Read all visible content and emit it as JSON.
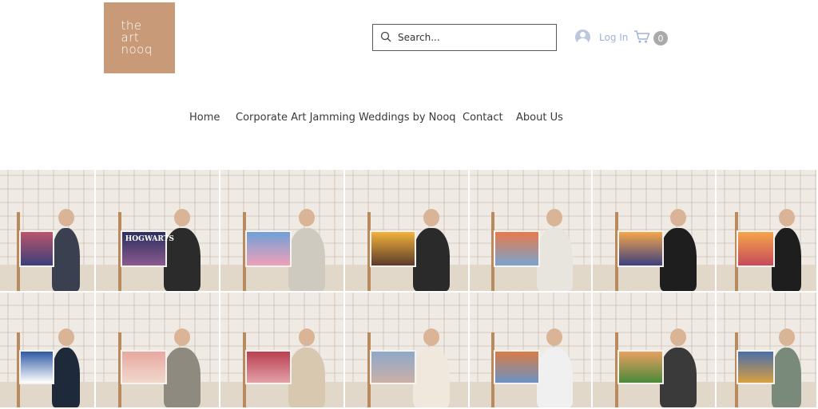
{
  "logo": {
    "lines": [
      "the",
      "art",
      "nooq"
    ],
    "bg_color": "#c89a78"
  },
  "search": {
    "placeholder": "Search...",
    "icon": "search-icon"
  },
  "account": {
    "login_label": "Log In",
    "icon": "user-avatar-icon",
    "color": "#a2b2d6"
  },
  "cart": {
    "count": "0",
    "icon": "cart-icon"
  },
  "nav": {
    "items": [
      {
        "label": "Home"
      },
      {
        "label": "Corporate Art Jamming"
      },
      {
        "label": "Weddings by Nooq"
      },
      {
        "label": "Contact"
      },
      {
        "label": "About Us"
      }
    ]
  },
  "gallery": {
    "rows": 2,
    "columns": 7,
    "photos": [
      {
        "canvas_text": ""
      },
      {
        "canvas_text": "HOGWARTS"
      },
      {
        "canvas_text": ""
      },
      {
        "canvas_text": ""
      },
      {
        "canvas_text": ""
      },
      {
        "canvas_text": ""
      },
      {
        "canvas_text": ""
      },
      {
        "canvas_text": ""
      },
      {
        "canvas_text": ""
      },
      {
        "canvas_text": ""
      },
      {
        "canvas_text": ""
      },
      {
        "canvas_text": ""
      },
      {
        "canvas_text": ""
      },
      {
        "canvas_text": ""
      }
    ]
  }
}
